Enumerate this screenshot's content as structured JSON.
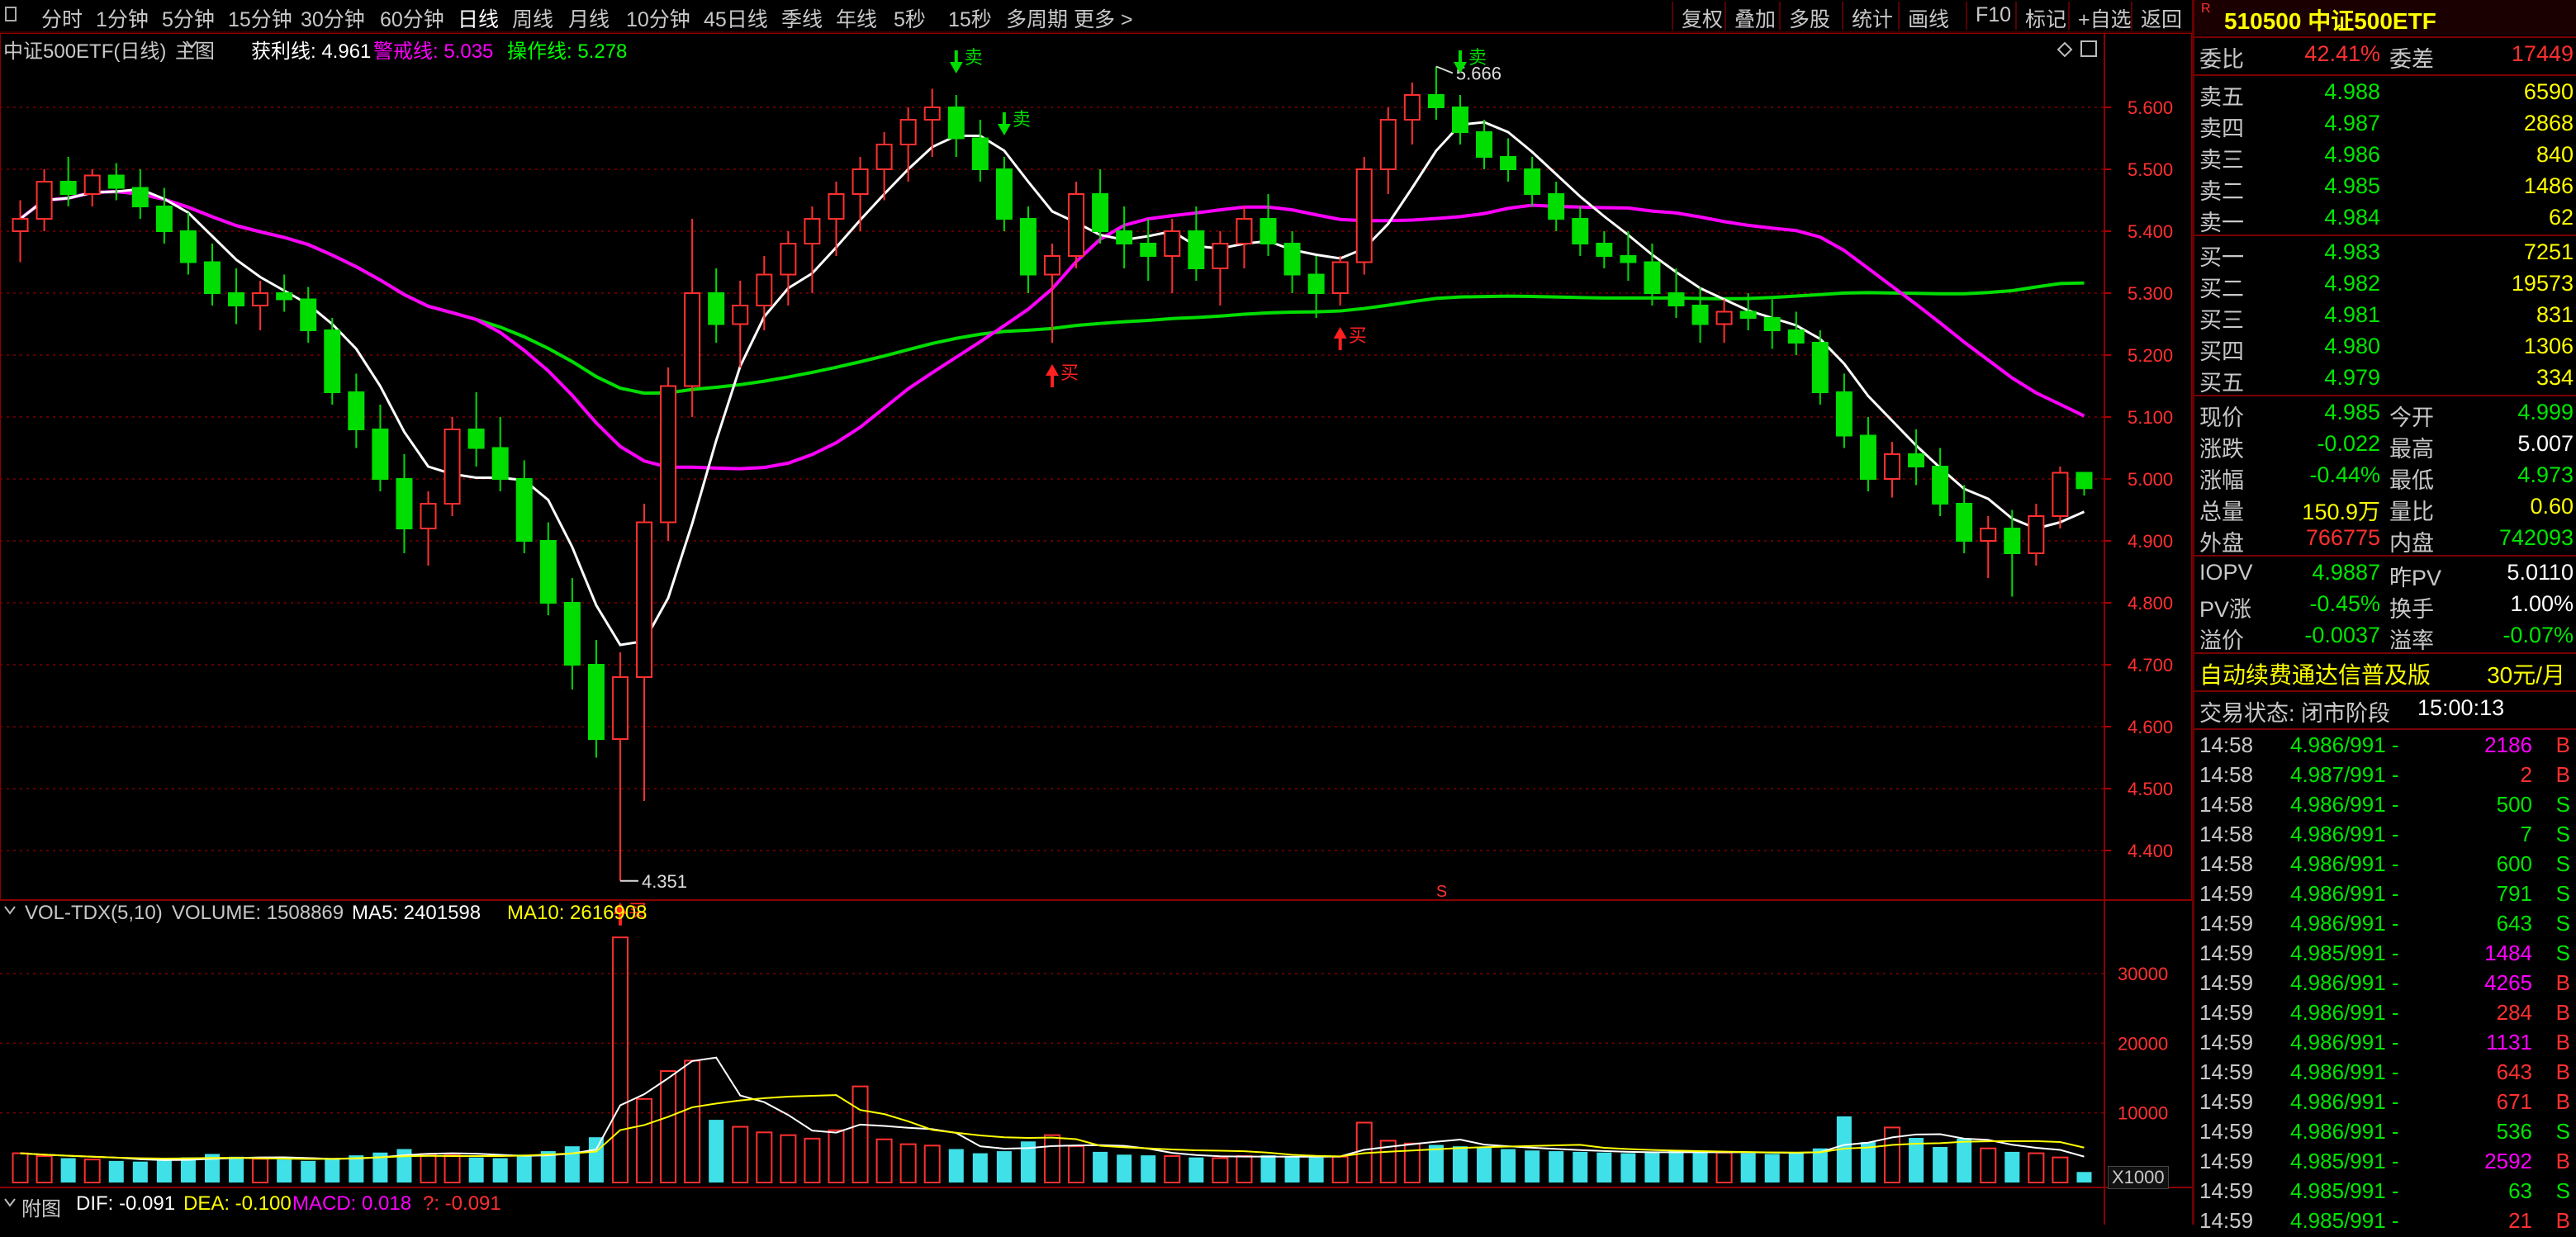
{
  "toolbar": {
    "period_items": [
      "分时",
      "1分钟",
      "5分钟",
      "15分钟",
      "30分钟",
      "60分钟",
      "日线",
      "周线",
      "月线",
      "10分钟",
      "45日线",
      "季线",
      "年线",
      "5秒",
      "15秒",
      "多周期",
      "更多 >"
    ],
    "active_index": 6,
    "right_items": [
      "复权",
      "叠加",
      "多股",
      "统计",
      "画线",
      "F10",
      "标记",
      "+自选",
      "返回"
    ]
  },
  "main_chart": {
    "title": "中证500ETF(日线)",
    "indicator_label": "主图",
    "profit_label": "获利线: 4.961",
    "warn_label": "警戒线: 5.035",
    "op_label": "操作线: 5.278",
    "price_ticks": [
      "5.600",
      "5.500",
      "5.400",
      "5.300",
      "5.200",
      "5.100",
      "5.000",
      "4.900",
      "4.800",
      "4.700",
      "4.600",
      "4.500",
      "4.400"
    ],
    "high_label": "5.666",
    "low_label": "4.351",
    "signal_buy": "买",
    "signal_sell": "卖",
    "s_marker": "S"
  },
  "volume_chart": {
    "title": "VOL-TDX(5,10)",
    "volume": "VOLUME: 1508869",
    "ma5": "MA5: 2401598",
    "ma10": "MA10: 2616908",
    "ticks": [
      "30000",
      "20000",
      "10000"
    ],
    "unit": "X1000"
  },
  "macd_bar": {
    "label": "附图",
    "dif": "DIF: -0.091",
    "dea": "DEA: -0.100",
    "macd": "MACD: 0.018",
    "q": "?: -0.091"
  },
  "quote": {
    "code_name": "510500 中证500ETF",
    "weibi_label": "委比",
    "weibi": "42.41%",
    "weicha_label": "委差",
    "weicha": "17449",
    "asks": [
      {
        "label": "卖五",
        "price": "4.988",
        "vol": "6590"
      },
      {
        "label": "卖四",
        "price": "4.987",
        "vol": "2868"
      },
      {
        "label": "卖三",
        "price": "4.986",
        "vol": "840"
      },
      {
        "label": "卖二",
        "price": "4.985",
        "vol": "1486"
      },
      {
        "label": "卖一",
        "price": "4.984",
        "vol": "62"
      }
    ],
    "bids": [
      {
        "label": "买一",
        "price": "4.983",
        "vol": "7251"
      },
      {
        "label": "买二",
        "price": "4.982",
        "vol": "19573"
      },
      {
        "label": "买三",
        "price": "4.981",
        "vol": "831"
      },
      {
        "label": "买四",
        "price": "4.980",
        "vol": "1306"
      },
      {
        "label": "买五",
        "price": "4.979",
        "vol": "334"
      }
    ],
    "stats": [
      {
        "l1": "现价",
        "v1": "4.985",
        "c1": "green",
        "l2": "今开",
        "v2": "4.999",
        "c2": "green"
      },
      {
        "l1": "涨跌",
        "v1": "-0.022",
        "c1": "green",
        "l2": "最高",
        "v2": "5.007",
        "c2": "white"
      },
      {
        "l1": "涨幅",
        "v1": "-0.44%",
        "c1": "green",
        "l2": "最低",
        "v2": "4.973",
        "c2": "green"
      },
      {
        "l1": "总量",
        "v1": "150.9万",
        "c1": "yellow",
        "l2": "量比",
        "v2": "0.60",
        "c2": "yellow"
      },
      {
        "l1": "外盘",
        "v1": "766775",
        "c1": "red",
        "l2": "内盘",
        "v2": "742093",
        "c2": "green"
      }
    ],
    "iopv": [
      {
        "l1": "IOPV",
        "v1": "4.9887",
        "c1": "green",
        "l2": "昨PV",
        "v2": "5.0110",
        "c2": "white"
      },
      {
        "l1": "PV涨",
        "v1": "-0.45%",
        "c1": "green",
        "l2": "换手",
        "v2": "1.00%",
        "c2": "white"
      },
      {
        "l1": "溢价",
        "v1": "-0.0037",
        "c1": "green",
        "l2": "溢率",
        "v2": "-0.07%",
        "c2": "green"
      }
    ],
    "ad_text": "自动续费通达信普及版",
    "ad_price": "30元/月",
    "status_text": "交易状态: 闭市阶段",
    "status_time": "15:00:13"
  },
  "ticks": [
    {
      "time": "14:58",
      "price": "4.986/991 -",
      "vol": "2186",
      "side": "B"
    },
    {
      "time": "14:58",
      "price": "4.987/991 -",
      "vol": "2",
      "side": "B"
    },
    {
      "time": "14:58",
      "price": "4.986/991 -",
      "vol": "500",
      "side": "S"
    },
    {
      "time": "14:58",
      "price": "4.986/991 -",
      "vol": "7",
      "side": "S"
    },
    {
      "time": "14:58",
      "price": "4.986/991 -",
      "vol": "600",
      "side": "S"
    },
    {
      "time": "14:59",
      "price": "4.986/991 -",
      "vol": "791",
      "side": "S"
    },
    {
      "time": "14:59",
      "price": "4.986/991 -",
      "vol": "643",
      "side": "S"
    },
    {
      "time": "14:59",
      "price": "4.985/991 -",
      "vol": "1484",
      "side": "S"
    },
    {
      "time": "14:59",
      "price": "4.986/991 -",
      "vol": "4265",
      "side": "B"
    },
    {
      "time": "14:59",
      "price": "4.986/991 -",
      "vol": "284",
      "side": "B"
    },
    {
      "time": "14:59",
      "price": "4.986/991 -",
      "vol": "1131",
      "side": "B"
    },
    {
      "time": "14:59",
      "price": "4.986/991 -",
      "vol": "643",
      "side": "B"
    },
    {
      "time": "14:59",
      "price": "4.986/991 -",
      "vol": "671",
      "side": "B"
    },
    {
      "time": "14:59",
      "price": "4.986/991 -",
      "vol": "536",
      "side": "S"
    },
    {
      "time": "14:59",
      "price": "4.985/991 -",
      "vol": "2592",
      "side": "B"
    },
    {
      "time": "14:59",
      "price": "4.985/991 -",
      "vol": "63",
      "side": "S"
    },
    {
      "time": "14:59",
      "price": "4.985/991 -",
      "vol": "21",
      "side": "B"
    }
  ],
  "chart_data": {
    "type": "candlestick",
    "ylim": [
      4.32,
      5.72
    ],
    "candles": [
      [
        5.4,
        5.45,
        5.35,
        5.42
      ],
      [
        5.42,
        5.5,
        5.4,
        5.48
      ],
      [
        5.48,
        5.52,
        5.44,
        5.46
      ],
      [
        5.46,
        5.5,
        5.44,
        5.49
      ],
      [
        5.49,
        5.51,
        5.45,
        5.47
      ],
      [
        5.47,
        5.5,
        5.42,
        5.44
      ],
      [
        5.44,
        5.47,
        5.38,
        5.4
      ],
      [
        5.4,
        5.43,
        5.33,
        5.35
      ],
      [
        5.35,
        5.38,
        5.28,
        5.3
      ],
      [
        5.3,
        5.34,
        5.25,
        5.28
      ],
      [
        5.28,
        5.32,
        5.24,
        5.3
      ],
      [
        5.3,
        5.33,
        5.27,
        5.29
      ],
      [
        5.29,
        5.31,
        5.22,
        5.24
      ],
      [
        5.24,
        5.26,
        5.12,
        5.14
      ],
      [
        5.14,
        5.17,
        5.05,
        5.08
      ],
      [
        5.08,
        5.12,
        4.98,
        5.0
      ],
      [
        5.0,
        5.04,
        4.88,
        4.92
      ],
      [
        4.92,
        4.98,
        4.86,
        4.96
      ],
      [
        4.96,
        5.1,
        4.94,
        5.08
      ],
      [
        5.08,
        5.14,
        5.02,
        5.05
      ],
      [
        5.05,
        5.1,
        4.98,
        5.0
      ],
      [
        5.0,
        5.03,
        4.88,
        4.9
      ],
      [
        4.9,
        4.93,
        4.78,
        4.8
      ],
      [
        4.8,
        4.84,
        4.66,
        4.7
      ],
      [
        4.7,
        4.74,
        4.55,
        4.58
      ],
      [
        4.58,
        4.72,
        4.351,
        4.68
      ],
      [
        4.68,
        4.96,
        4.48,
        4.93
      ],
      [
        4.93,
        5.18,
        4.9,
        5.15
      ],
      [
        5.15,
        5.42,
        5.1,
        5.3
      ],
      [
        5.3,
        5.34,
        5.22,
        5.25
      ],
      [
        5.25,
        5.32,
        5.18,
        5.28
      ],
      [
        5.28,
        5.36,
        5.24,
        5.33
      ],
      [
        5.33,
        5.4,
        5.28,
        5.38
      ],
      [
        5.38,
        5.44,
        5.3,
        5.42
      ],
      [
        5.42,
        5.48,
        5.36,
        5.46
      ],
      [
        5.46,
        5.52,
        5.4,
        5.5
      ],
      [
        5.5,
        5.56,
        5.45,
        5.54
      ],
      [
        5.54,
        5.6,
        5.48,
        5.58
      ],
      [
        5.58,
        5.63,
        5.52,
        5.6
      ],
      [
        5.6,
        5.62,
        5.52,
        5.55
      ],
      [
        5.55,
        5.58,
        5.48,
        5.5
      ],
      [
        5.5,
        5.52,
        5.4,
        5.42
      ],
      [
        5.42,
        5.44,
        5.3,
        5.33
      ],
      [
        5.33,
        5.38,
        5.22,
        5.36
      ],
      [
        5.36,
        5.48,
        5.34,
        5.46
      ],
      [
        5.46,
        5.5,
        5.38,
        5.4
      ],
      [
        5.4,
        5.44,
        5.34,
        5.38
      ],
      [
        5.38,
        5.42,
        5.32,
        5.36
      ],
      [
        5.36,
        5.42,
        5.3,
        5.4
      ],
      [
        5.4,
        5.44,
        5.32,
        5.34
      ],
      [
        5.34,
        5.4,
        5.28,
        5.38
      ],
      [
        5.38,
        5.44,
        5.34,
        5.42
      ],
      [
        5.42,
        5.46,
        5.36,
        5.38
      ],
      [
        5.38,
        5.4,
        5.3,
        5.33
      ],
      [
        5.33,
        5.36,
        5.26,
        5.3
      ],
      [
        5.3,
        5.36,
        5.28,
        5.35
      ],
      [
        5.35,
        5.52,
        5.33,
        5.5
      ],
      [
        5.5,
        5.6,
        5.46,
        5.58
      ],
      [
        5.58,
        5.64,
        5.54,
        5.62
      ],
      [
        5.62,
        5.666,
        5.58,
        5.6
      ],
      [
        5.6,
        5.62,
        5.54,
        5.56
      ],
      [
        5.56,
        5.58,
        5.5,
        5.52
      ],
      [
        5.52,
        5.55,
        5.48,
        5.5
      ],
      [
        5.5,
        5.52,
        5.44,
        5.46
      ],
      [
        5.46,
        5.48,
        5.4,
        5.42
      ],
      [
        5.42,
        5.44,
        5.36,
        5.38
      ],
      [
        5.38,
        5.4,
        5.34,
        5.36
      ],
      [
        5.36,
        5.4,
        5.32,
        5.35
      ],
      [
        5.35,
        5.38,
        5.28,
        5.3
      ],
      [
        5.3,
        5.34,
        5.26,
        5.28
      ],
      [
        5.28,
        5.31,
        5.22,
        5.25
      ],
      [
        5.25,
        5.29,
        5.22,
        5.27
      ],
      [
        5.27,
        5.3,
        5.24,
        5.26
      ],
      [
        5.26,
        5.29,
        5.21,
        5.24
      ],
      [
        5.24,
        5.27,
        5.2,
        5.22
      ],
      [
        5.22,
        5.24,
        5.12,
        5.14
      ],
      [
        5.14,
        5.17,
        5.05,
        5.07
      ],
      [
        5.07,
        5.1,
        4.98,
        5.0
      ],
      [
        5.0,
        5.06,
        4.97,
        5.04
      ],
      [
        5.04,
        5.08,
        4.99,
        5.02
      ],
      [
        5.02,
        5.05,
        4.94,
        4.96
      ],
      [
        4.96,
        4.99,
        4.88,
        4.9
      ],
      [
        4.9,
        4.94,
        4.84,
        4.92
      ],
      [
        4.92,
        4.95,
        4.81,
        4.88
      ],
      [
        4.88,
        4.96,
        4.86,
        4.94
      ],
      [
        4.94,
        5.02,
        4.92,
        5.01
      ],
      [
        5.01,
        5.01,
        4.973,
        4.985
      ]
    ],
    "volumes": [
      4200,
      3800,
      3500,
      3300,
      3100,
      3000,
      3200,
      3600,
      4100,
      3700,
      3400,
      3300,
      3100,
      3500,
      3900,
      4300,
      4800,
      4100,
      3900,
      3600,
      3500,
      4000,
      4500,
      5200,
      6500,
      35200,
      12000,
      16000,
      17500,
      9000,
      8000,
      7200,
      6800,
      6300,
      7500,
      13800,
      6200,
      5500,
      5300,
      4800,
      4200,
      4500,
      5900,
      6800,
      5200,
      4400,
      4000,
      3900,
      3800,
      3600,
      3500,
      3800,
      3900,
      3700,
      3600,
      3700,
      8600,
      6000,
      5600,
      5400,
      5200,
      5000,
      4800,
      4600,
      4500,
      4400,
      4300,
      4200,
      4300,
      4500,
      4400,
      4300,
      4200,
      4100,
      4300,
      4900,
      9500,
      5800,
      7900,
      6400,
      5100,
      6300,
      4900,
      4400,
      4200,
      3600,
      1508
    ],
    "vol_ylim": [
      0,
      37000
    ]
  }
}
